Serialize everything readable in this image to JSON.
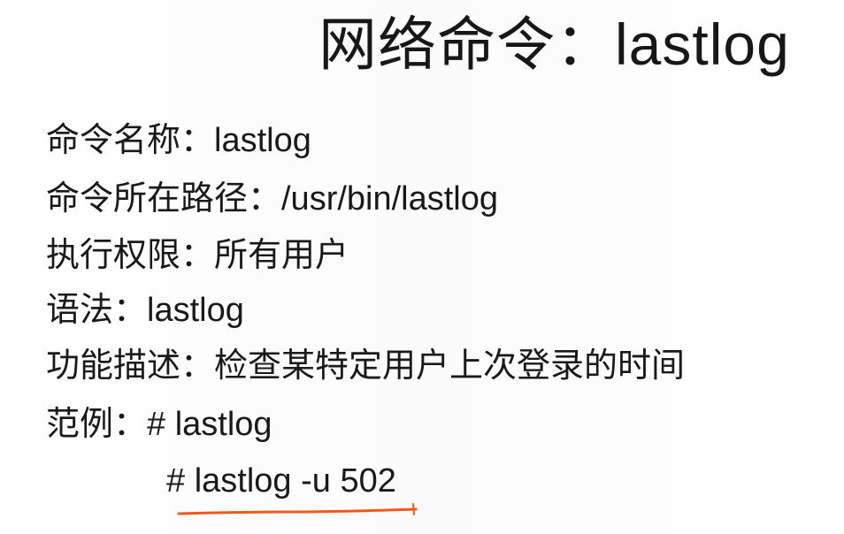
{
  "slide": {
    "title": "网络命令：lastlog",
    "lines": [
      "命令名称：lastlog",
      "命令所在路径：/usr/bin/lastlog",
      "执行权限：所有用户",
      "语法：lastlog",
      "功能描述：检查某特定用户上次登录的时间",
      "范例：# lastlog",
      "# lastlog -u 502"
    ]
  },
  "annotation": {
    "underline_color": "#ef5a1c"
  }
}
